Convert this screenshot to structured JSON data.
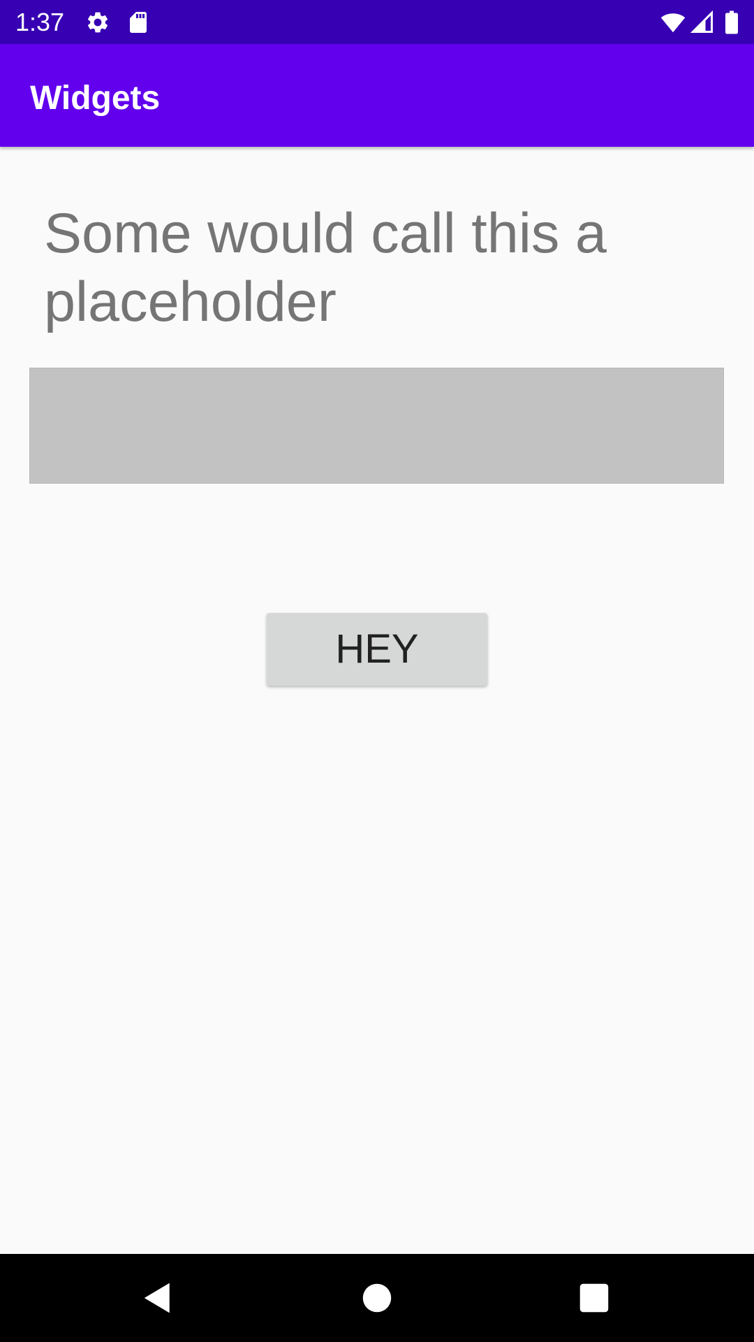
{
  "status_bar": {
    "time": "1:37",
    "icons": [
      "gear-icon",
      "sd-card-icon",
      "wifi-icon",
      "signal-icon",
      "battery-icon"
    ],
    "color": "#3700b3"
  },
  "app_bar": {
    "title": "Widgets",
    "color": "#6200ee"
  },
  "main": {
    "headline": "Some would call this a placeholder",
    "placeholder_box_color": "#c2c2c2",
    "button_label": "HEY"
  },
  "nav_bar": {
    "icons": [
      "back-icon",
      "home-icon",
      "recents-icon"
    ]
  }
}
